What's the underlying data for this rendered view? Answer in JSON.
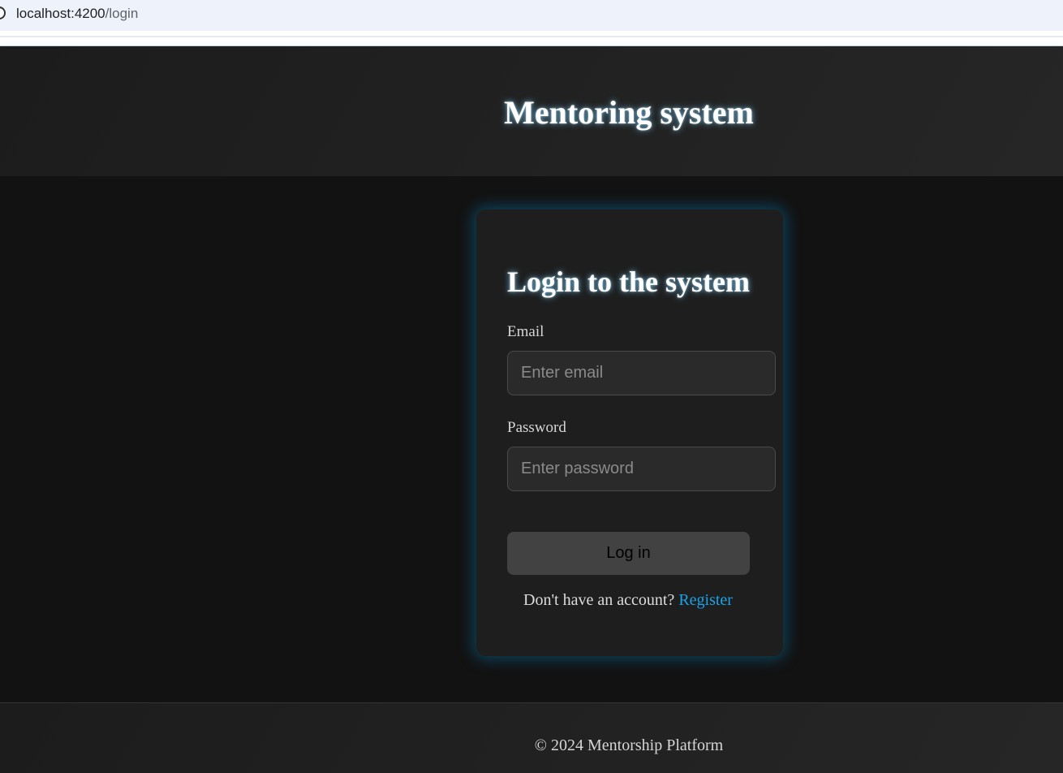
{
  "browser": {
    "url_host": "localhost:4200",
    "url_path": "/login"
  },
  "header": {
    "title": "Mentoring system"
  },
  "login": {
    "title": "Login to the system",
    "email_label": "Email",
    "email_placeholder": "Enter email",
    "email_value": "",
    "password_label": "Password",
    "password_placeholder": "Enter password",
    "password_value": "",
    "submit_label": "Log in",
    "register_prompt": "Don't have an account?",
    "register_link": "Register"
  },
  "footer": {
    "text": "© 2024 Mentorship Platform"
  },
  "colors": {
    "background": "#121212",
    "card": "#1e1e1e",
    "glow": "#00a0e6",
    "link": "#1aa3e8"
  }
}
